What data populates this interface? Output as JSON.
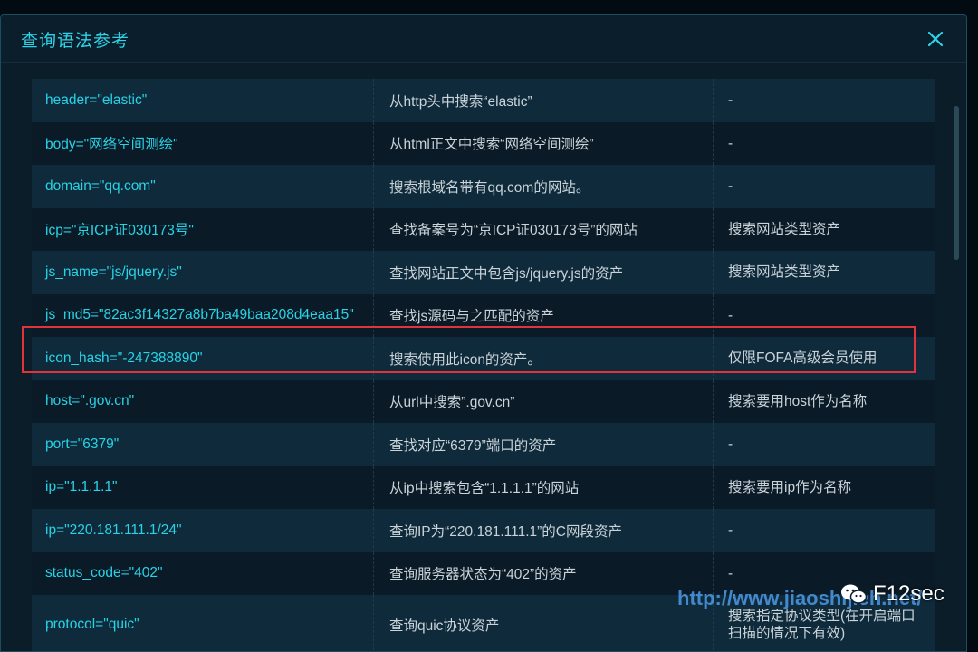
{
  "modal": {
    "title": "查询语法参考"
  },
  "rows": [
    {
      "syntax": "header=\"elastic\"",
      "desc": "从http头中搜索“elastic”",
      "note": "-"
    },
    {
      "syntax": "body=\"网络空间测绘\"",
      "desc": "从html正文中搜索“网络空间测绘”",
      "note": "-"
    },
    {
      "syntax": "domain=\"qq.com\"",
      "desc": "搜索根域名带有qq.com的网站。",
      "note": "-"
    },
    {
      "syntax": "icp=\"京ICP证030173号\"",
      "desc": "查找备案号为“京ICP证030173号”的网站",
      "note": "搜索网站类型资产"
    },
    {
      "syntax": "js_name=\"js/jquery.js\"",
      "desc": "查找网站正文中包含js/jquery.js的资产",
      "note": "搜索网站类型资产"
    },
    {
      "syntax": "js_md5=\"82ac3f14327a8b7ba49baa208d4eaa15\"",
      "desc": "查找js源码与之匹配的资产",
      "note": "-"
    },
    {
      "syntax": "icon_hash=\"-247388890\"",
      "desc": "搜索使用此icon的资产。",
      "note": "仅限FOFA高级会员使用"
    },
    {
      "syntax": "host=\".gov.cn\"",
      "desc": "从url中搜索”.gov.cn”",
      "note": "搜索要用host作为名称"
    },
    {
      "syntax": "port=\"6379\"",
      "desc": "查找对应“6379”端口的资产",
      "note": "-"
    },
    {
      "syntax": "ip=\"1.1.1.1\"",
      "desc": "从ip中搜索包含“1.1.1.1”的网站",
      "note": "搜索要用ip作为名称"
    },
    {
      "syntax": "ip=\"220.181.111.1/24\"",
      "desc": "查询IP为“220.181.111.1”的C网段资产",
      "note": "-"
    },
    {
      "syntax": "status_code=\"402\"",
      "desc": "查询服务器状态为“402”的资产",
      "note": "-"
    },
    {
      "syntax": "protocol=\"quic\"",
      "desc": "查询quic协议资产",
      "note": "搜索指定协议类型(在开启端口\n扫描的情况下有效)"
    }
  ],
  "watermark": {
    "url": "http://www.jiaoshijieh.net/",
    "brand": "F12sec"
  },
  "colors": {
    "accent": "#2fd3e8",
    "highlight": "#e0343d"
  }
}
